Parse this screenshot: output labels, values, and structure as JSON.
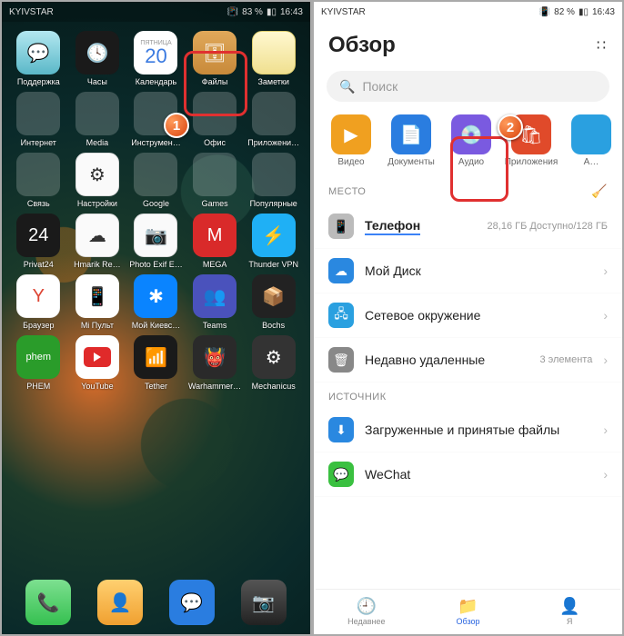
{
  "statusbar": {
    "carrier": "KYIVSTAR",
    "time": "16:43",
    "battery_left": "83 %",
    "battery_right": "82 %",
    "vibrate_icon": "vibrate"
  },
  "home": {
    "rows": [
      [
        {
          "label": "Поддержка",
          "cls": "ic-support",
          "glyph": "💬"
        },
        {
          "label": "Часы",
          "cls": "ic-clock",
          "glyph": "🕓"
        },
        {
          "label": "Календарь",
          "cls": "ic-cal",
          "cal_day": "ПЯТНИЦА",
          "cal_num": "20"
        },
        {
          "label": "Файлы",
          "cls": "ic-files",
          "glyph": "🗄"
        },
        {
          "label": "Заметки",
          "cls": "ic-notes",
          "glyph": ""
        }
      ],
      [
        {
          "label": "Интернет",
          "folder": true
        },
        {
          "label": "Media",
          "folder": true
        },
        {
          "label": "Инструмен…",
          "folder": true
        },
        {
          "label": "Офис",
          "folder": true
        },
        {
          "label": "Приложени…",
          "folder": true
        }
      ],
      [
        {
          "label": "Связь",
          "folder": true
        },
        {
          "label": "Настройки",
          "cls": "ic-white",
          "glyph": "⚙"
        },
        {
          "label": "Google",
          "folder": true
        },
        {
          "label": "Games",
          "folder": true
        },
        {
          "label": "Популярные",
          "folder": true
        }
      ],
      [
        {
          "label": "Privat24",
          "cls": "ic-privat",
          "glyph": "24"
        },
        {
          "label": "Hmarik Re…",
          "cls": "ic-white",
          "glyph": "☁"
        },
        {
          "label": "Photo Exif E…",
          "cls": "ic-white",
          "glyph": "📷"
        },
        {
          "label": "MEGA",
          "cls": "ic-mega",
          "glyph": "M"
        },
        {
          "label": "Thunder VPN",
          "cls": "ic-tvpn",
          "glyph": "⚡"
        }
      ],
      [
        {
          "label": "Браузер",
          "cls": "ic-ya",
          "glyph": "Y"
        },
        {
          "label": "Mi Пульт",
          "cls": "ic-mi",
          "glyph": "📱"
        },
        {
          "label": "Мой Киевс…",
          "cls": "ic-kyiv",
          "glyph": "✱"
        },
        {
          "label": "Teams",
          "cls": "ic-teams",
          "glyph": "👥"
        },
        {
          "label": "Bochs",
          "cls": "ic-bochs",
          "glyph": "📦"
        }
      ],
      [
        {
          "label": "PHEM",
          "cls": "ic-phem",
          "glyph": "phem"
        },
        {
          "label": "YouTube",
          "cls": "ic-yt",
          "yt": true
        },
        {
          "label": "Tether",
          "cls": "ic-tether",
          "glyph": "📶"
        },
        {
          "label": "Warhammer…",
          "cls": "ic-wrh",
          "glyph": "👹"
        },
        {
          "label": "Mechanicus",
          "cls": "ic-mech",
          "glyph": "⚙"
        }
      ]
    ],
    "dock": [
      {
        "name": "phone",
        "cls": "ic-phone",
        "glyph": "📞"
      },
      {
        "name": "contacts",
        "cls": "ic-contacts",
        "glyph": "👤"
      },
      {
        "name": "messages",
        "cls": "ic-msg",
        "glyph": "💬"
      },
      {
        "name": "camera",
        "cls": "ic-cam",
        "glyph": "📷"
      }
    ]
  },
  "files": {
    "title": "Обзор",
    "search_placeholder": "Поиск",
    "categories": [
      {
        "label": "Видео",
        "color": "#f0a020",
        "glyph": "▶"
      },
      {
        "label": "Документы",
        "color": "#2a7de0",
        "glyph": "📄"
      },
      {
        "label": "Аудио",
        "color": "#7a5ae0",
        "glyph": "💿"
      },
      {
        "label": "Приложения",
        "color": "#e04a2a",
        "glyph": "🛍"
      },
      {
        "label": "А…",
        "color": "#2aa0e0",
        "glyph": ""
      }
    ],
    "place_header": "МЕСТО",
    "places": [
      {
        "title": "Телефон",
        "sub": "28,16 ГБ Доступно/128 ГБ",
        "icon": "#bbb",
        "glyph": "📱",
        "bold": true,
        "underline": true
      },
      {
        "title": "Мой Диск",
        "icon": "#2a88e0",
        "glyph": "☁",
        "chev": true
      },
      {
        "title": "Сетевое окружение",
        "icon": "#2aa0e0",
        "glyph": "🖧",
        "chev": true
      },
      {
        "title": "Недавно удаленные",
        "side": "3 элемента",
        "icon": "#888",
        "glyph": "🗑",
        "chev": true
      }
    ],
    "source_header": "ИСТОЧНИК",
    "sources": [
      {
        "title": "Загруженные и принятые файлы",
        "icon": "#2a88e0",
        "glyph": "⬇",
        "chev": true
      },
      {
        "title": "WeChat",
        "icon": "#3ac040",
        "glyph": "💬",
        "chev": true
      }
    ],
    "nav": [
      {
        "label": "Недавнее",
        "glyph": "🕘"
      },
      {
        "label": "Обзор",
        "glyph": "📁",
        "active": true
      },
      {
        "label": "Я",
        "glyph": "👤"
      }
    ]
  },
  "badges": {
    "one": "1",
    "two": "2"
  }
}
